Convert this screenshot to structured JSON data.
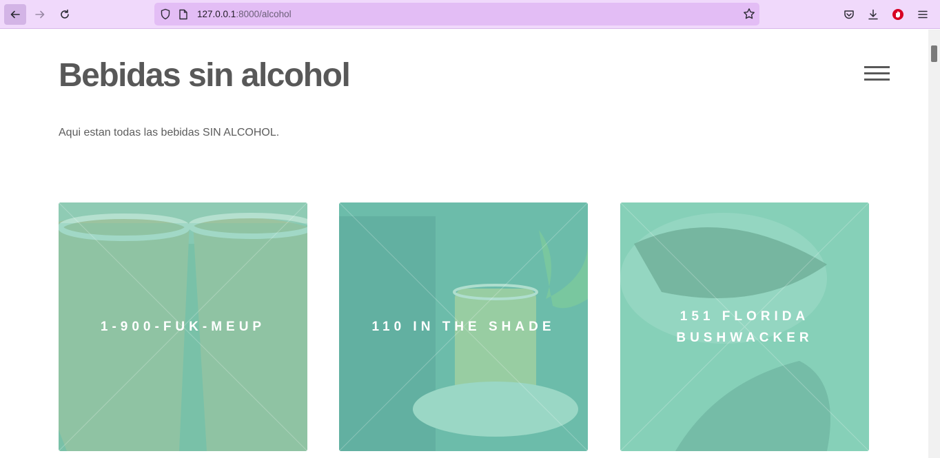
{
  "browser": {
    "url_host": "127.0.0.1",
    "url_path": ":8000/alcohol",
    "icons": [
      "back-icon",
      "forward-icon",
      "reload-icon",
      "shield-icon",
      "page-icon",
      "star-icon",
      "pocket-icon",
      "download-icon",
      "extension-icon",
      "menu-icon"
    ]
  },
  "page": {
    "title": "Bebidas sin alcohol",
    "description": "Aqui estan todas las bebidas SIN ALCOHOL."
  },
  "cards": [
    {
      "name": "1-900-FUK-MEUP"
    },
    {
      "name": "110 in the shade"
    },
    {
      "name": "151 Florida Bushwacker"
    }
  ],
  "colors": {
    "toolbar": "#f0d9fb",
    "urlbar": "#e3bdf5",
    "heading": "#585858",
    "card_overlay": "#6fc7b0"
  }
}
